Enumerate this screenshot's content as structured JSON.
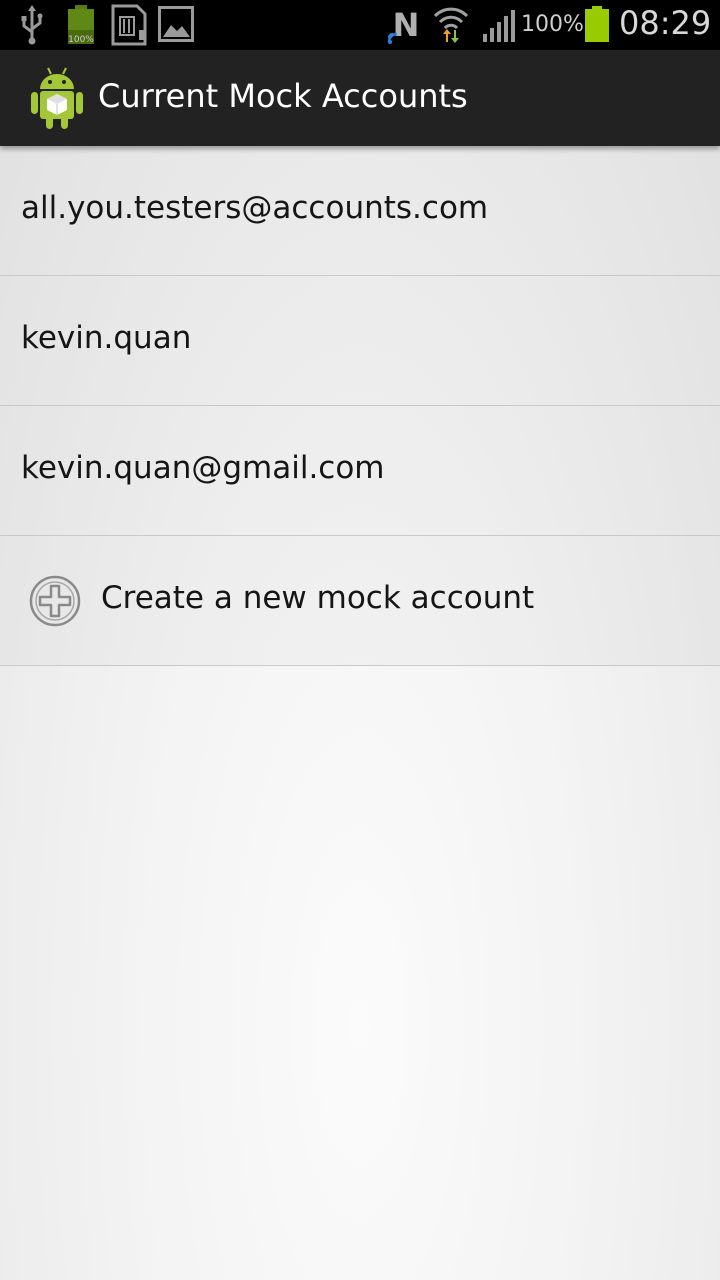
{
  "status_bar": {
    "icons": [
      "usb-icon",
      "battery-full-icon",
      "sd-card-icon",
      "image-icon",
      "nfc-icon",
      "wifi-icon",
      "signal-icon",
      "battery-icon"
    ],
    "battery_mini_label": "100%",
    "battery_percent": "100%",
    "time": "08:29",
    "battery_color": "#99cc00"
  },
  "action_bar": {
    "title": "Current Mock Accounts",
    "icon": "android-app-icon"
  },
  "accounts": [
    {
      "label": "all.you.testers@accounts.com"
    },
    {
      "label": "kevin.quan"
    },
    {
      "label": "kevin.quan@gmail.com"
    }
  ],
  "create_item": {
    "label": "Create a new mock account",
    "icon": "add-circle-icon"
  }
}
